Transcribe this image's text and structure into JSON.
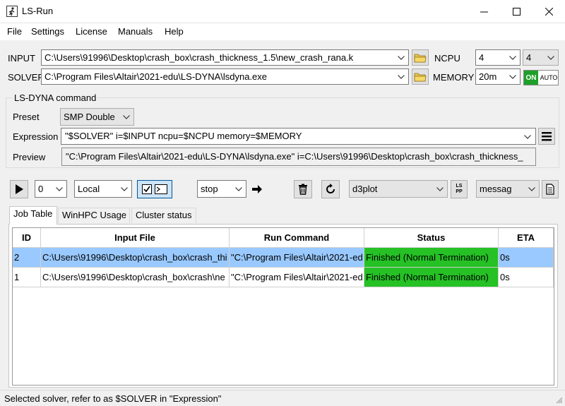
{
  "window": {
    "title": "LS-Run"
  },
  "menu": [
    "File",
    "Settings",
    "License",
    "Manuals",
    "Help"
  ],
  "input": {
    "label": "INPUT",
    "value": "C:\\Users\\91996\\Desktop\\crash_box\\crash_thickness_1.5\\new_crash_rana.k"
  },
  "solver": {
    "label": "SOLVER",
    "value": "C:\\Program Files\\Altair\\2021-edu\\LS-DYNA\\lsdyna.exe"
  },
  "ncpu": {
    "label": "NCPU",
    "value1": "4",
    "value2": "4"
  },
  "memory": {
    "label": "MEMORY",
    "value": "20m",
    "toggle_on": "ON",
    "toggle_auto": "AUTO"
  },
  "command": {
    "group_title": "LS-DYNA command",
    "preset_label": "Preset",
    "preset_value": "SMP Double",
    "expression_label": "Expression",
    "expression_value": "\"$SOLVER\" i=$INPUT ncpu=$NCPU memory=$MEMORY",
    "preview_label": "Preview",
    "preview_value": "\"C:\\Program Files\\Altair\\2021-edu\\LS-DYNA\\lsdyna.exe\" i=C:\\Users\\91996\\Desktop\\crash_box\\crash_thickness_"
  },
  "toolbar": {
    "count_value": "0",
    "location_value": "Local",
    "action_value": "stop",
    "output_value": "d3plot",
    "log_value": "messag",
    "lspp_label": "LS PP"
  },
  "tabs": [
    "Job Table",
    "WinHPC Usage",
    "Cluster status"
  ],
  "table": {
    "columns": [
      "ID",
      "Input File",
      "Run Command",
      "Status",
      "ETA"
    ],
    "rows": [
      {
        "id": "2",
        "input": "C:\\Users\\91996\\Desktop\\crash_box\\crash_thi",
        "command": "\"C:\\Program Files\\Altair\\2021-ed",
        "status": "Finished (Normal Termination)",
        "eta": "0s"
      },
      {
        "id": "1",
        "input": "C:\\Users\\91996\\Desktop\\crash_box\\crash\\ne",
        "command": "\"C:\\Program Files\\Altair\\2021-ed",
        "status": "Finished (Normal Termination)",
        "eta": "0s"
      }
    ]
  },
  "status_bar": {
    "text": "Selected solver, refer to as $SOLVER in \"Expression\""
  },
  "colors": {
    "accent_on": "#1e9f2a",
    "status_green": "#25c125",
    "selection": "#99c9ff"
  },
  "icons": [
    "app-icon",
    "minimize-icon",
    "maximize-icon",
    "close-icon",
    "folder-icon",
    "chevron-down-icon",
    "hamburger-icon",
    "play-icon",
    "checkbox-icon",
    "terminal-icon",
    "arrow-right-icon",
    "trash-icon",
    "refresh-icon",
    "document-icon"
  ]
}
